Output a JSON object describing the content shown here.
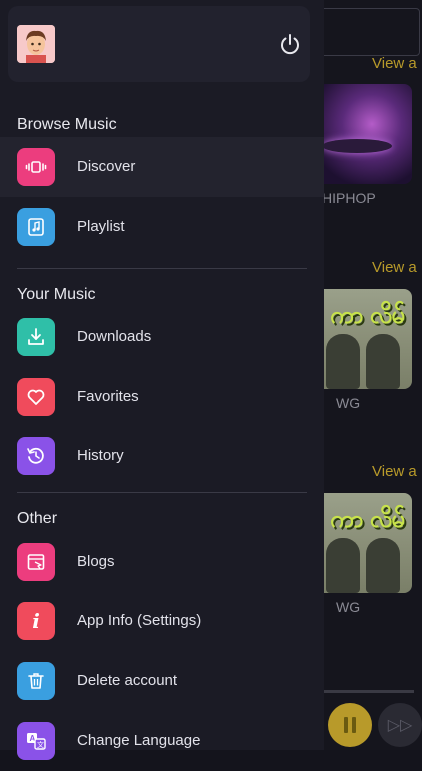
{
  "background": {
    "view_all_label": "View a",
    "cards": [
      {
        "label": "HIPHOP"
      },
      {
        "label": "WG",
        "art_text": "ကာ လိမ်"
      },
      {
        "label": "WG",
        "art_text": "ကာ လိမ်"
      }
    ]
  },
  "drawer": {
    "sections": [
      {
        "title": "Browse Music",
        "items": [
          {
            "label": "Discover",
            "icon": "discover-icon",
            "color": "#ec3d7e",
            "active": true
          },
          {
            "label": "Playlist",
            "icon": "playlist-icon",
            "color": "#3a9fe0",
            "active": false
          }
        ]
      },
      {
        "title": "Your Music",
        "items": [
          {
            "label": "Downloads",
            "icon": "download-icon",
            "color": "#2fbfa8"
          },
          {
            "label": "Favorites",
            "icon": "heart-icon",
            "color": "#f04b5c"
          },
          {
            "label": "History",
            "icon": "history-icon",
            "color": "#8a52e8"
          }
        ]
      },
      {
        "title": "Other",
        "items": [
          {
            "label": "Blogs",
            "icon": "blog-icon",
            "color": "#ec3d7e"
          },
          {
            "label": "App Info (Settings)",
            "icon": "info-icon",
            "color": "#f04b5c"
          },
          {
            "label": "Delete account",
            "icon": "trash-icon",
            "color": "#3a9fe0"
          },
          {
            "label": "Change Language",
            "icon": "language-icon",
            "color": "#8a52e8"
          }
        ]
      }
    ]
  },
  "colors": {
    "accent_gold": "#b89a2a",
    "drawer_bg": "#1b1b25"
  }
}
